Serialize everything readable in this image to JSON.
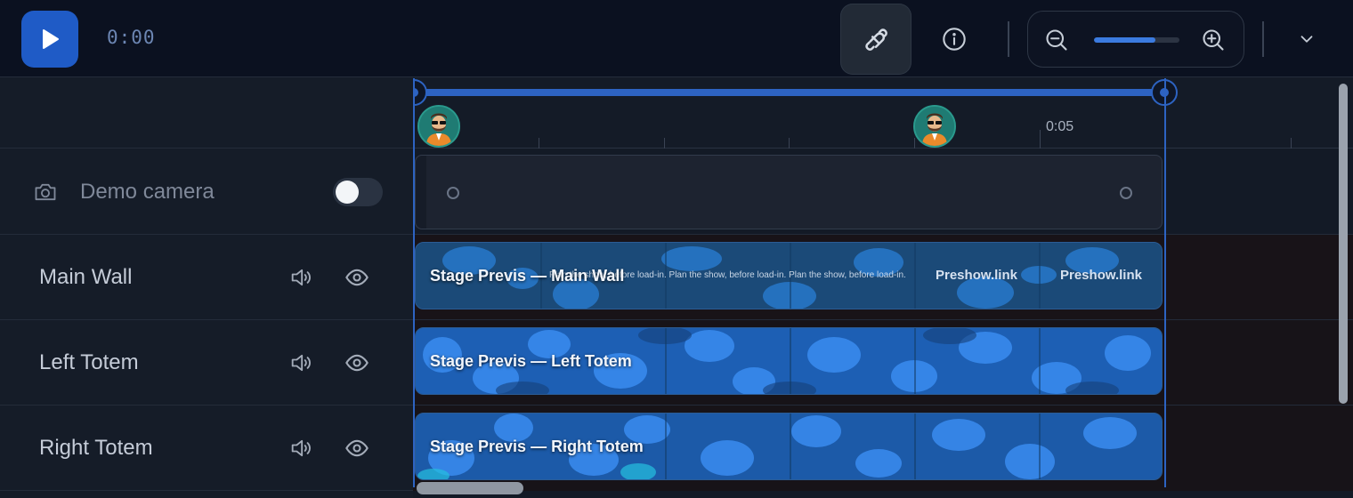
{
  "toolbar": {
    "play_icon": "play-icon",
    "timecode": "0:00",
    "snap_icon": "magnet-icon",
    "info_icon": "info-icon",
    "zoom_out_icon": "zoom-out-icon",
    "zoom_in_icon": "zoom-in-icon",
    "zoom_level": 0.72,
    "expand_icon": "chevron-down-icon"
  },
  "ruler": {
    "tick_label": "0:05"
  },
  "tracks": [
    {
      "name": "Demo camera",
      "icon": "camera-icon",
      "toggle_on": false
    },
    {
      "name": "Main Wall",
      "clip_title": "Stage Previs — Main Wall",
      "marquee": "Plan the show, before load-in. Plan the show, before load-in. Plan the show, before load-in.",
      "brand_1": "Preshow.link",
      "brand_2": "Preshow.link"
    },
    {
      "name": "Left Totem",
      "clip_title": "Stage Previs — Left Totem"
    },
    {
      "name": "Right Totem",
      "clip_title": "Stage Previs — Right Totem"
    }
  ],
  "colors": {
    "accent": "#2d63c2",
    "play_button": "#1f5bc6",
    "toolbar_bg": "#0b1120"
  }
}
